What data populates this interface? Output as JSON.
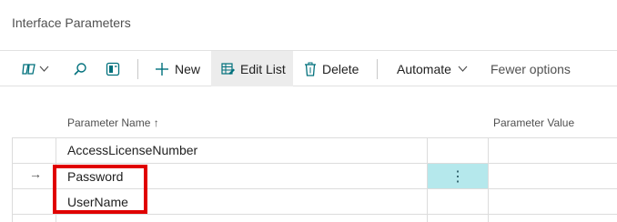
{
  "page": {
    "title": "Interface Parameters"
  },
  "toolbar": {
    "new_label": "New",
    "edit_list_label": "Edit List",
    "delete_label": "Delete",
    "automate_label": "Automate",
    "fewer_options_label": "Fewer options",
    "icons": [
      "filter-pane-icon",
      "chevron-down-icon",
      "search-icon",
      "open-in-excel-icon",
      "plus-icon",
      "edit-list-icon",
      "trash-icon"
    ]
  },
  "table": {
    "columns": [
      {
        "label": "Parameter Name ↑"
      },
      {
        "label": "Parameter Value"
      }
    ],
    "rows": [
      {
        "name": "AccessLicenseNumber",
        "value": ""
      },
      {
        "name": "Password",
        "value": "",
        "selected": true
      },
      {
        "name": "UserName",
        "value": ""
      }
    ],
    "row_indicator": "→",
    "actions_glyph": "⋮"
  },
  "colors": {
    "active_cell": "#b5e8ec",
    "annotation": "#e00000",
    "accent": "#00707c"
  }
}
